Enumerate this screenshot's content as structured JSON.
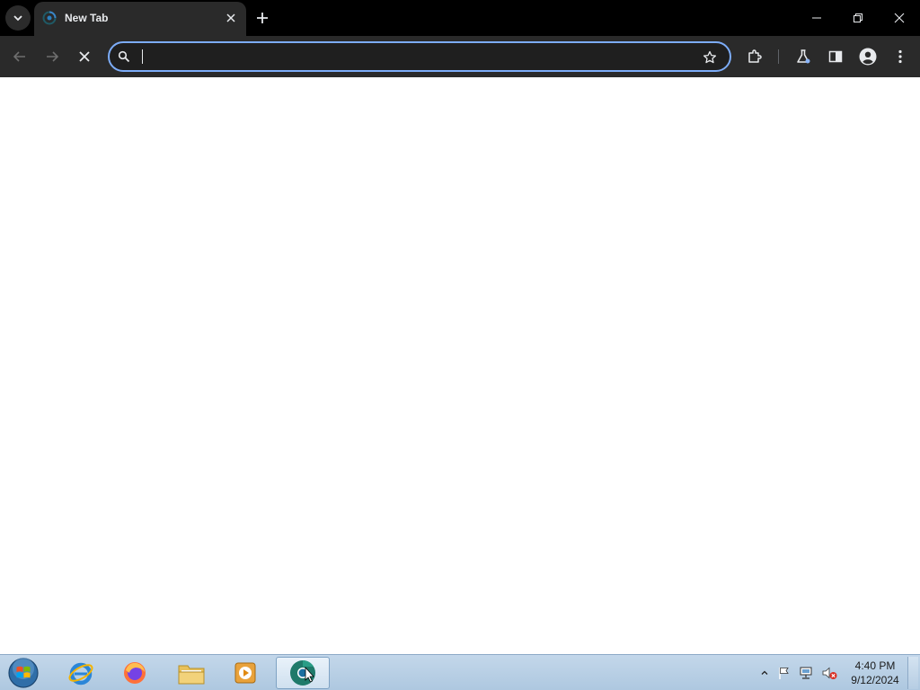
{
  "browser": {
    "tab": {
      "title": "New Tab"
    },
    "omnibox": {
      "value": "",
      "placeholder": ""
    }
  },
  "icons": {
    "tab_search": "chevron-down-icon",
    "favicon": "chrome-loading-icon",
    "tab_close": "close-icon",
    "new_tab": "plus-icon",
    "back": "arrow-left-icon",
    "forward": "arrow-right-icon",
    "stop": "stop-x-icon",
    "search": "search-icon",
    "bookmark": "star-icon",
    "extensions": "puzzle-icon",
    "labs": "flask-icon",
    "side_panel": "side-panel-icon",
    "profile": "profile-icon",
    "menu": "kebab-menu-icon"
  },
  "taskbar": {
    "apps": [
      "windows-start-orb",
      "internet-explorer",
      "firefox",
      "file-explorer",
      "media-player",
      "chrome-canary"
    ],
    "clock": {
      "time": "4:40 PM",
      "date": "9/12/2024"
    }
  },
  "colors": {
    "tabstrip": "#000000",
    "toolbar": "#2a2a2a",
    "omnibox_border": "#7cacf8",
    "taskbar": "#b9cfe4"
  }
}
